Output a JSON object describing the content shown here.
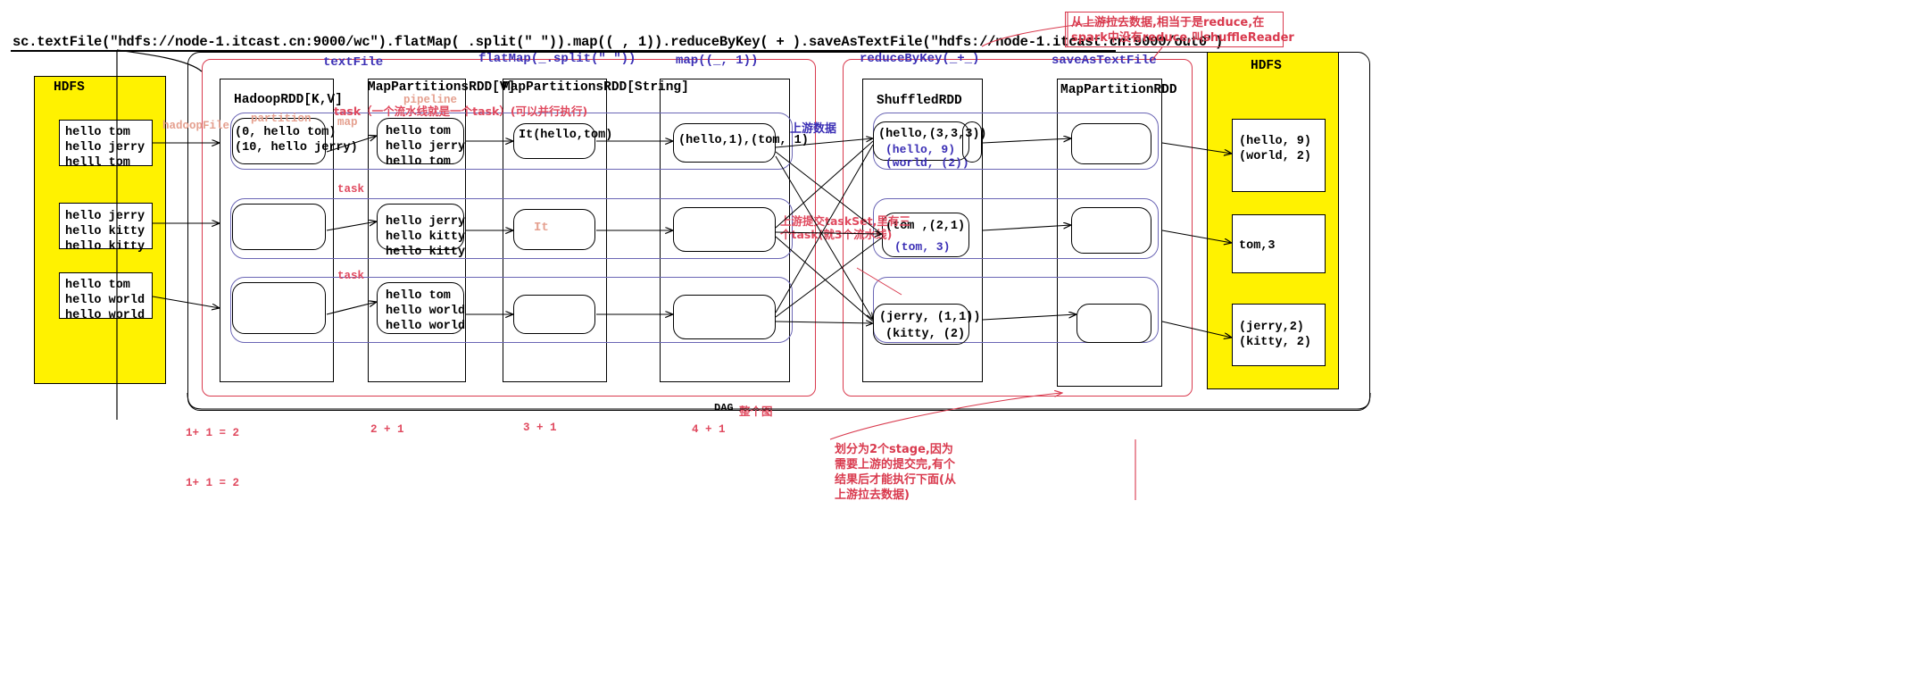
{
  "code": {
    "line": "sc.textFile(\"hdfs://node-1.itcast.cn:9000/wc\").flatMap( .split(\" \")).map(( , 1)).reduceByKey( + ).saveAsTextFile(\"hdfs://node-1.itcast.cn:9000/out0\")"
  },
  "annotations": {
    "top_right": "从上游拉去数据,相当于是reduce,在\nspark中没有reduce,叫shuffleReader",
    "bottom": "划分为2个stage,因为\n需要上游的提交完,有个\n结果后才能执行下面(从\n上游拉去数据)",
    "task_pipeline": "task（一个流水线就是一个task）(可以并行执行)",
    "pipeline": "pipeline",
    "task2": "task",
    "task3": "task",
    "upstream_data": "上游数据",
    "upstream_tasks": "上游提交taskSet,里有三\n个task(就3个流水线)",
    "hadoop_file": "hadoopFile",
    "partition": "partition",
    "map": "map",
    "dag": "DAG",
    "dag_cn": "整个图"
  },
  "stage_labels": {
    "textFile": "textFile",
    "flatMap": "flatMap(_.split(\" \"))",
    "map": "map((_, 1))",
    "reduceByKey": "reduceByKey(_+_)",
    "saveAsTextFile": "saveAsTextFile"
  },
  "hdfs_left": {
    "title": "HDFS",
    "blocks": [
      "hello tom\nhello jerry\nhelll tom",
      "hello jerry\nhello kitty\nhello kitty",
      "hello tom\nhello world\nhello world"
    ]
  },
  "hdfs_right": {
    "title": "HDFS",
    "blocks": [
      "(hello, 9)\n(world, 2)",
      "tom,3",
      "(jerry,2)\n(kitty, 2)"
    ]
  },
  "rdds": {
    "hadoop": {
      "title": "HadoopRDD[K,V]",
      "partitions": [
        "(0, hello tom)\n(10, hello jerry)",
        "",
        ""
      ]
    },
    "mapPartitionsV": {
      "title": "MapPartitionsRDD[V]",
      "partitions": [
        "hello tom\nhello jerry\nhello tom",
        "hello jerry\nhello kitty\nhello kitty",
        "hello tom\nhello world\nhello world"
      ]
    },
    "mapPartitionsString": {
      "title": "MapPartitionsRDD[String]",
      "partitions": [
        "It(hello,tom)",
        "It",
        ""
      ]
    },
    "mapPair": {
      "title": "",
      "partitions": [
        "(hello,1),(tom, 1)",
        "",
        ""
      ]
    },
    "shuffled": {
      "title": "ShuffledRDD",
      "partitions": [
        "(hello,(3,3,3))",
        "(tom ,(2,1)",
        "(jerry, (1,1))"
      ],
      "sub": [
        "(hello, 9)\n(world, (2))",
        "(tom, 3)",
        "(kitty, (2)"
      ]
    },
    "mapPartition": {
      "title": "MapPartitionRDD",
      "partitions": [
        "",
        "",
        ""
      ]
    }
  },
  "counts": [
    "1+ 1 = 2",
    "2 + 1",
    "3 + 1",
    "4 + 1"
  ],
  "count_bottom": "1+ 1 = 2"
}
